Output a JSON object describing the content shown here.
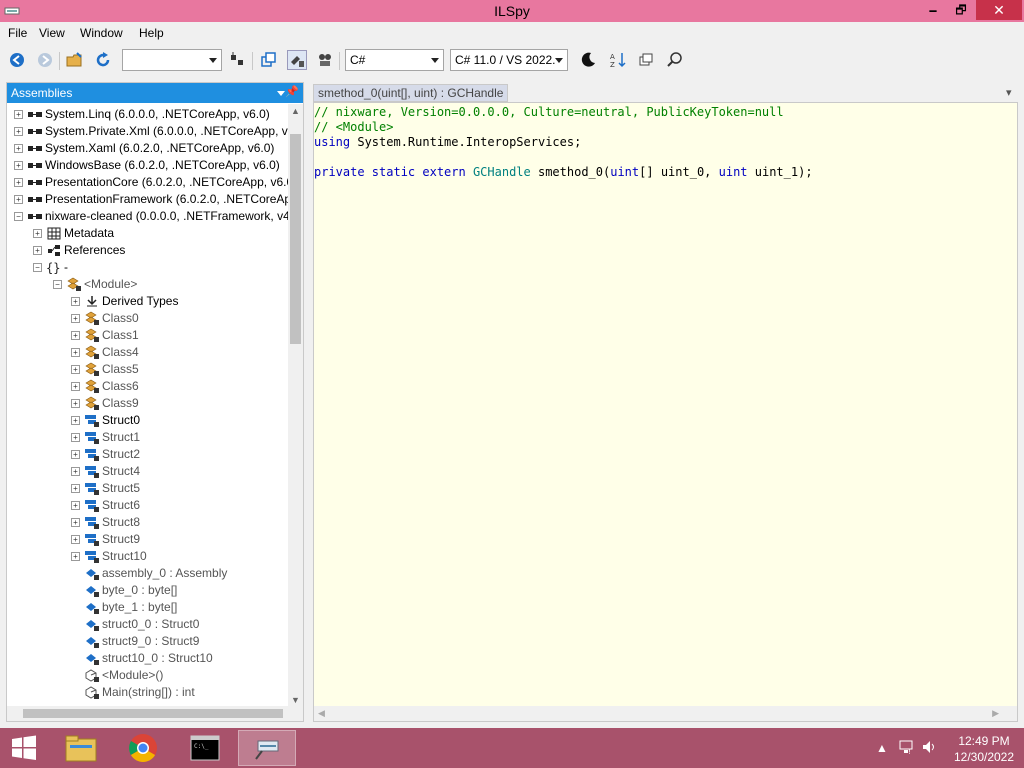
{
  "window": {
    "title": "ILSpy",
    "minimize": "🗕",
    "maximize": "🗗",
    "close": "✕"
  },
  "menu": [
    "File",
    "View",
    "Window",
    "Help"
  ],
  "toolbar": {
    "search_combo_value": "",
    "language_value": "C#",
    "version_value": "C# 11.0 / VS 2022.​",
    "icons": [
      "back-icon",
      "forward-icon",
      "open-icon",
      "reload-icon",
      "sort-icon",
      "show-all-icon",
      "api-visibility-icon",
      "internal-icon",
      "theme-icon",
      "sort-assemblies-icon",
      "manage-lists-icon",
      "search-icon"
    ]
  },
  "assemblies_panel": {
    "title": "Assemblies",
    "pin": "📌",
    "nodes": [
      {
        "label": "System.Linq (6.0.0.0, .NETCoreApp, v6.0)",
        "depth": 0,
        "expander": "+",
        "icon": "assembly"
      },
      {
        "label": "System.Private.Xml (6.0.0.0, .NETCoreApp, v6.0)",
        "depth": 0,
        "expander": "+",
        "icon": "assembly"
      },
      {
        "label": "System.Xaml (6.0.2.0, .NETCoreApp, v6.0)",
        "depth": 0,
        "expander": "+",
        "icon": "assembly"
      },
      {
        "label": "WindowsBase (6.0.2.0, .NETCoreApp, v6.0)",
        "depth": 0,
        "expander": "+",
        "icon": "assembly"
      },
      {
        "label": "PresentationCore (6.0.2.0, .NETCoreApp, v6.0)",
        "depth": 0,
        "expander": "+",
        "icon": "assembly"
      },
      {
        "label": "PresentationFramework (6.0.2.0, .NETCoreApp, v6.0)",
        "depth": 0,
        "expander": "+",
        "icon": "assembly"
      },
      {
        "label": "nixware-cleaned (0.0.0.0, .NETFramework, v4.7.2)",
        "depth": 0,
        "expander": "−",
        "icon": "assembly"
      },
      {
        "label": "Metadata",
        "depth": 1,
        "expander": "+",
        "icon": "metadata"
      },
      {
        "label": "References",
        "depth": 1,
        "expander": "+",
        "icon": "references"
      },
      {
        "label": "-",
        "depth": 1,
        "expander": "−",
        "icon": "namespace"
      },
      {
        "label": "<Module>",
        "depth": 2,
        "expander": "−",
        "icon": "class",
        "gray": true
      },
      {
        "label": "Derived Types",
        "depth": 3,
        "expander": "+",
        "icon": "derived"
      },
      {
        "label": "Class0",
        "depth": 3,
        "expander": "+",
        "icon": "class",
        "gray": true
      },
      {
        "label": "Class1",
        "depth": 3,
        "expander": "+",
        "icon": "class",
        "gray": true
      },
      {
        "label": "Class4",
        "depth": 3,
        "expander": "+",
        "icon": "class",
        "gray": true
      },
      {
        "label": "Class5",
        "depth": 3,
        "expander": "+",
        "icon": "class",
        "gray": true
      },
      {
        "label": "Class6",
        "depth": 3,
        "expander": "+",
        "icon": "class",
        "gray": true
      },
      {
        "label": "Class9",
        "depth": 3,
        "expander": "+",
        "icon": "class",
        "gray": true
      },
      {
        "label": "Struct0",
        "depth": 3,
        "expander": "+",
        "icon": "struct"
      },
      {
        "label": "Struct1",
        "depth": 3,
        "expander": "+",
        "icon": "struct",
        "gray": true
      },
      {
        "label": "Struct2",
        "depth": 3,
        "expander": "+",
        "icon": "struct",
        "gray": true
      },
      {
        "label": "Struct4",
        "depth": 3,
        "expander": "+",
        "icon": "struct",
        "gray": true
      },
      {
        "label": "Struct5",
        "depth": 3,
        "expander": "+",
        "icon": "struct",
        "gray": true
      },
      {
        "label": "Struct6",
        "depth": 3,
        "expander": "+",
        "icon": "struct",
        "gray": true
      },
      {
        "label": "Struct8",
        "depth": 3,
        "expander": "+",
        "icon": "struct",
        "gray": true
      },
      {
        "label": "Struct9",
        "depth": 3,
        "expander": "+",
        "icon": "struct",
        "gray": true
      },
      {
        "label": "Struct10",
        "depth": 3,
        "expander": "+",
        "icon": "struct",
        "gray": true
      },
      {
        "label": "assembly_0 : Assembly",
        "depth": 3,
        "expander": "",
        "icon": "field",
        "gray": true
      },
      {
        "label": "byte_0 : byte[]",
        "depth": 3,
        "expander": "",
        "icon": "field",
        "gray": true
      },
      {
        "label": "byte_1 : byte[]",
        "depth": 3,
        "expander": "",
        "icon": "field",
        "gray": true
      },
      {
        "label": "struct0_0 : Struct0",
        "depth": 3,
        "expander": "",
        "icon": "field",
        "gray": true
      },
      {
        "label": "struct9_0 : Struct9",
        "depth": 3,
        "expander": "",
        "icon": "field",
        "gray": true
      },
      {
        "label": "struct10_0 : Struct10",
        "depth": 3,
        "expander": "",
        "icon": "field",
        "gray": true
      },
      {
        "label": "<Module>()",
        "depth": 3,
        "expander": "",
        "icon": "method",
        "gray": true
      },
      {
        "label": "Main(string[]) : int",
        "depth": 3,
        "expander": "",
        "icon": "method",
        "gray": true
      }
    ]
  },
  "document": {
    "tab_title": "smethod_0(uint[], uint) : GCHandle",
    "code_lines": [
      [
        {
          "t": "// nixware, Version=0.0.0.0, Culture=neutral, PublicKeyToken=null",
          "c": "cmt"
        }
      ],
      [
        {
          "t": "// <Module>",
          "c": "cmt"
        }
      ],
      [
        {
          "t": "using",
          "c": "kw"
        },
        {
          "t": " System.Runtime.InteropServices;",
          "c": ""
        }
      ],
      [
        {
          "t": "",
          "c": ""
        }
      ],
      [
        {
          "t": "private static extern",
          "c": "kw"
        },
        {
          "t": " ",
          "c": ""
        },
        {
          "t": "GCHandle",
          "c": "typ"
        },
        {
          "t": " smethod_0(",
          "c": ""
        },
        {
          "t": "uint",
          "c": "kw"
        },
        {
          "t": "[] uint_0, ",
          "c": ""
        },
        {
          "t": "uint",
          "c": "kw"
        },
        {
          "t": " uint_1);",
          "c": ""
        }
      ]
    ]
  },
  "taskbar": {
    "apps": [
      "start-icon",
      "file-explorer-icon",
      "chrome-icon",
      "cmd-icon",
      "ilspy-icon"
    ],
    "time": "12:49 PM",
    "date": "12/30/2022"
  },
  "colors": {
    "title_bar": "#e8779f",
    "taskbar": "#a8526b",
    "panel_header": "#1f8fe0",
    "editor_bg": "#ffffe8"
  }
}
